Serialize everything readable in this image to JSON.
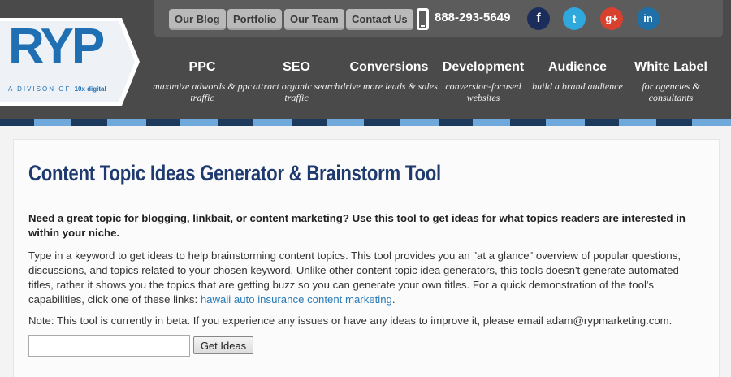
{
  "logo": {
    "text": "RYP",
    "sub_prefix": "A DIVISON OF",
    "sub_brand": "10x digital"
  },
  "topbar": {
    "links": [
      "Our Blog",
      "Portfolio",
      "Our Team",
      "Contact Us"
    ],
    "phone": "888-293-5649",
    "social": [
      {
        "icon": "facebook-icon",
        "glyph": "f",
        "color": "#1b2d5a"
      },
      {
        "icon": "twitter-icon",
        "glyph": "t",
        "color": "#2fa8dd"
      },
      {
        "icon": "google-plus-icon",
        "glyph": "g+",
        "color": "#d9412f"
      },
      {
        "icon": "linkedin-icon",
        "glyph": "in",
        "color": "#1f6fa8"
      }
    ]
  },
  "nav": [
    {
      "title": "PPC",
      "sub": "maximize adwords & ppc traffic"
    },
    {
      "title": "SEO",
      "sub": "attract organic search traffic"
    },
    {
      "title": "Conversions",
      "sub": "drive more leads & sales"
    },
    {
      "title": "Development",
      "sub": "conversion-focused websites"
    },
    {
      "title": "Audience",
      "sub": "build a brand audience"
    },
    {
      "title": "White Label",
      "sub": "for agencies & consultants"
    }
  ],
  "stripe_colors": [
    "#1d3a5c",
    "#6fa9dc",
    "#1d3a5c",
    "#6fa9dc"
  ],
  "content": {
    "title": "Content Topic Ideas Generator & Brainstorm Tool",
    "intro": "Need a great topic for blogging, linkbait, or content marketing? Use this tool to get ideas for what topics readers are interested in within your niche.",
    "body": "Type in a keyword to get ideas to help brainstorming content topics. This tool provides you an \"at a glance\" overview of popular questions, discussions, and topics related to your chosen keyword. Unlike other content topic idea generators, this tools doesn't generate automated titles, rather it shows you the topics that are getting buzz so you can generate your own titles. For a quick demonstration of the tool's capabilities, click one of these links: ",
    "demo_link": "hawaii auto insurance content marketing",
    "body_end": ".",
    "note": "Note: This tool is currently in beta. If you experience any issues or have any ideas to improve it, please email adam@rypmarketing.com.",
    "input_value": "",
    "button_label": "Get Ideas"
  }
}
